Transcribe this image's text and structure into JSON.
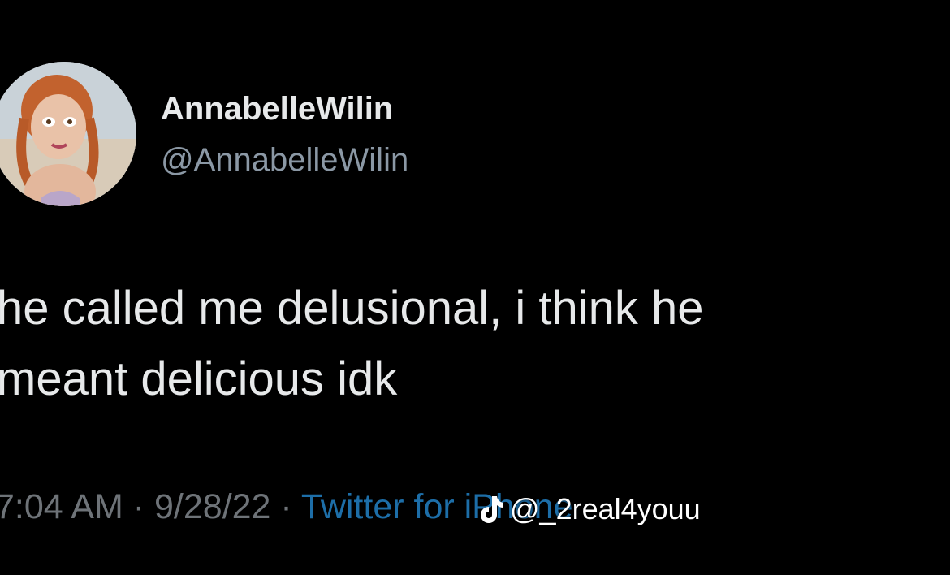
{
  "tweet": {
    "display_name": "AnnabelleWilin",
    "handle": "@AnnabelleWilin",
    "text_lines": [
      "he called me delusional, i think he",
      "meant delicious idk"
    ],
    "time": "7:04 AM",
    "separator": "·",
    "date": "9/28/22",
    "source": "Twitter for iPhone",
    "avatar_icon": "doll-avatar-icon"
  },
  "watermark": {
    "icon": "tiktok-icon",
    "text": "@_2real4youu"
  },
  "colors": {
    "background": "#000000",
    "primary_text": "#e7e9ea",
    "secondary_text": "#8b98a5",
    "link": "#1d6ea8"
  }
}
